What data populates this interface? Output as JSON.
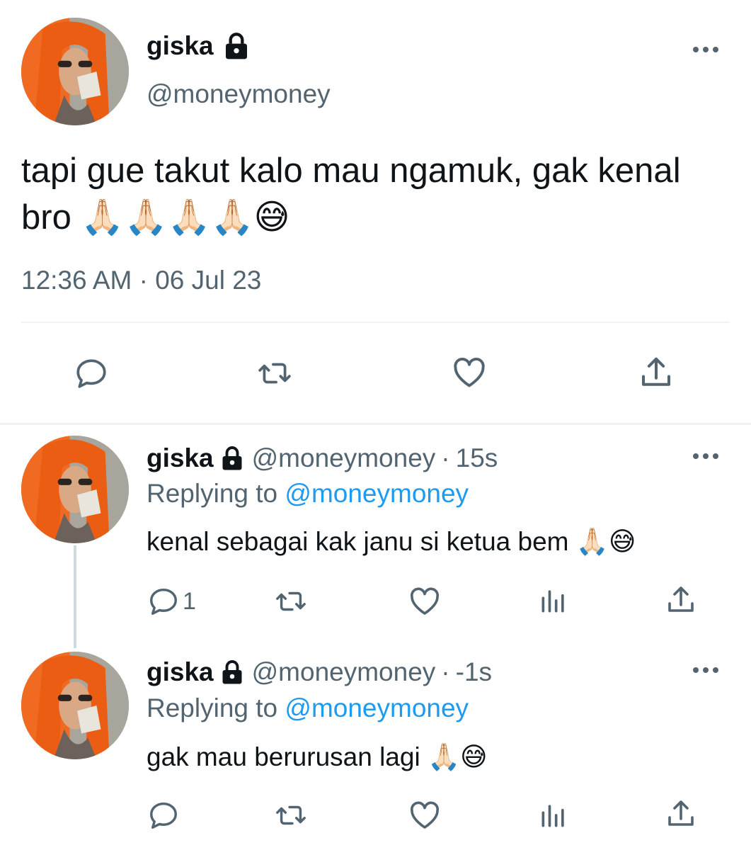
{
  "main_tweet": {
    "name": "giska",
    "handle": "@moneymoney",
    "text": "tapi gue takut kalo mau ngamuk, gak kenal bro 🙏🏻🙏🏻🙏🏻🙏🏻😅",
    "timestamp": "12:36 AM · 06 Jul 23",
    "actions": [
      "reply-icon",
      "retweet-icon",
      "like-icon",
      "share-icon"
    ]
  },
  "replies": [
    {
      "name": "giska",
      "handle": "@moneymoney",
      "dot": "·",
      "time": "15s",
      "replying_prefix": "Replying to ",
      "replying_to": "@moneymoney",
      "text": "kenal sebagai kak janu si ketua bem 🙏🏻😅",
      "reply_count": "1"
    },
    {
      "name": "giska",
      "handle": "@moneymoney",
      "dot": "·",
      "time": "-1s",
      "replying_prefix": "Replying to ",
      "replying_to": "@moneymoney",
      "text": "gak mau berurusan lagi 🙏🏻😅",
      "reply_count": ""
    }
  ],
  "colors": {
    "text_primary": "#0f1419",
    "text_secondary": "#536471",
    "accent": "#1d9bf0",
    "divider": "#eff3f4"
  }
}
